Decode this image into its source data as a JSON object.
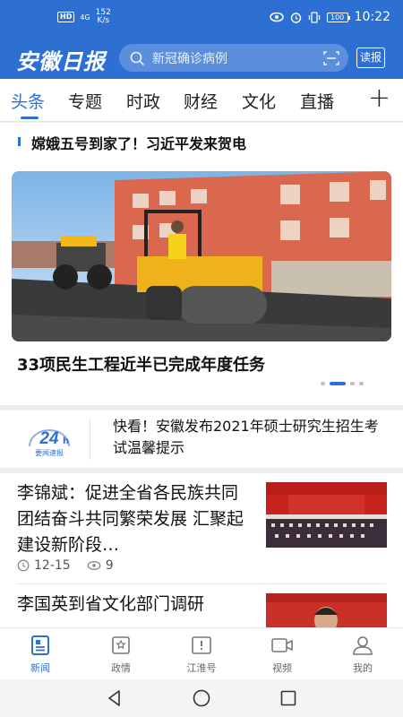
{
  "status_bar": {
    "hd": "HD",
    "network": "4G",
    "speed_value": "152",
    "speed_unit": "K/s",
    "battery": "100",
    "time": "10:22",
    "icons": [
      "eye-icon",
      "alarm-icon",
      "vibrate-icon",
      "battery-icon"
    ]
  },
  "header": {
    "logo_text": "安徽日报",
    "search_placeholder": "新冠确诊病例",
    "read_button": "读报",
    "brand_color": "#2e6fd3"
  },
  "tabs": {
    "items": [
      "头条",
      "专题",
      "时政",
      "财经",
      "文化",
      "直播"
    ],
    "active_index": 0,
    "add_label": "+"
  },
  "ticker": {
    "text": "嫦娥五号到家了！习近平发来贺电"
  },
  "hero": {
    "title": "33项民生工程近半已完成年度任务",
    "carousel_total": 4,
    "carousel_active_index": 1
  },
  "flash": {
    "badge_number": "24",
    "badge_text": "要闻速报",
    "text": "快看！安徽发布2021年硕士研究生招生考试温馨提示"
  },
  "news": [
    {
      "title": "李锦斌：促进全省各民族共同团结奋斗共同繁荣发展 汇聚起建设新阶段…",
      "date": "12-15",
      "views": "9"
    },
    {
      "title": "李国英到省文化部门调研",
      "date": "",
      "views": ""
    }
  ],
  "bottom_nav": {
    "items": [
      {
        "label": "新闻",
        "icon": "news-icon",
        "active": true
      },
      {
        "label": "政情",
        "icon": "government-icon",
        "active": false
      },
      {
        "label": "江淮号",
        "icon": "jianghuai-icon",
        "active": false
      },
      {
        "label": "视频",
        "icon": "video-icon",
        "active": false
      },
      {
        "label": "我的",
        "icon": "profile-icon",
        "active": false
      }
    ]
  },
  "system_nav": [
    "back-icon",
    "home-icon",
    "recents-icon"
  ]
}
